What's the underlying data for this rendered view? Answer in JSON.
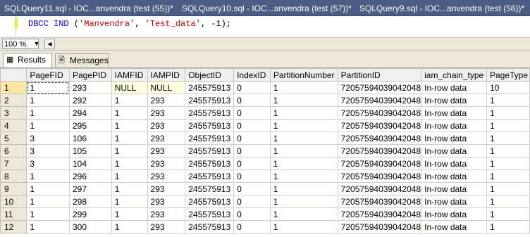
{
  "window_tabs": [
    {
      "label": "SQLQuery11.sql - IOC...anvendra (test (55))*"
    },
    {
      "label": "SQLQuery10.sql - IOC...anvendra (test (57))*"
    },
    {
      "label": "SQLQuery9.sql - IOC...anvendra (test (56))*"
    }
  ],
  "editor": {
    "kw": "DBCC IND",
    "open": " (",
    "arg1": "'Manvendra'",
    "sep": ", ",
    "arg2": "'Test_data'",
    "rest": ", -1);"
  },
  "zoom": {
    "value": "100 %"
  },
  "result_tabs": {
    "results": "Results",
    "messages": "Messages"
  },
  "grid": {
    "columns": [
      "PageFID",
      "PagePID",
      "IAMFID",
      "IAMPID",
      "ObjectID",
      "IndexID",
      "PartitionNumber",
      "PartitionID",
      "iam_chain_type",
      "PageType"
    ],
    "rows": [
      [
        "1",
        "1",
        "293",
        "NULL",
        "NULL",
        "245575913",
        "0",
        "1",
        "72057594039042048",
        "In-row data",
        "10"
      ],
      [
        "2",
        "1",
        "292",
        "1",
        "293",
        "245575913",
        "0",
        "1",
        "72057594039042048",
        "In-row data",
        "1"
      ],
      [
        "3",
        "1",
        "294",
        "1",
        "293",
        "245575913",
        "0",
        "1",
        "72057594039042048",
        "In-row data",
        "1"
      ],
      [
        "4",
        "1",
        "295",
        "1",
        "293",
        "245575913",
        "0",
        "1",
        "72057594039042048",
        "In-row data",
        "1"
      ],
      [
        "5",
        "3",
        "106",
        "1",
        "293",
        "245575913",
        "0",
        "1",
        "72057594039042048",
        "In-row data",
        "1"
      ],
      [
        "6",
        "3",
        "105",
        "1",
        "293",
        "245575913",
        "0",
        "1",
        "72057594039042048",
        "In-row data",
        "1"
      ],
      [
        "7",
        "3",
        "104",
        "1",
        "293",
        "245575913",
        "0",
        "1",
        "72057594039042048",
        "In-row data",
        "1"
      ],
      [
        "8",
        "1",
        "296",
        "1",
        "293",
        "245575913",
        "0",
        "1",
        "72057594039042048",
        "In-row data",
        "1"
      ],
      [
        "9",
        "1",
        "297",
        "1",
        "293",
        "245575913",
        "0",
        "1",
        "72057594039042048",
        "In-row data",
        "1"
      ],
      [
        "10",
        "1",
        "298",
        "1",
        "293",
        "245575913",
        "0",
        "1",
        "72057594039042048",
        "In-row data",
        "1"
      ],
      [
        "11",
        "1",
        "299",
        "1",
        "293",
        "245575913",
        "0",
        "1",
        "72057594039042048",
        "In-row data",
        "1"
      ],
      [
        "12",
        "1",
        "300",
        "1",
        "293",
        "245575913",
        "0",
        "1",
        "72057594039042048",
        "In-row data",
        "1"
      ]
    ]
  },
  "icons": {
    "results": "grid-icon",
    "messages": "document-icon",
    "zoom_dropdown": "chevron-down-icon",
    "scroll": "arrow-left-icon"
  }
}
